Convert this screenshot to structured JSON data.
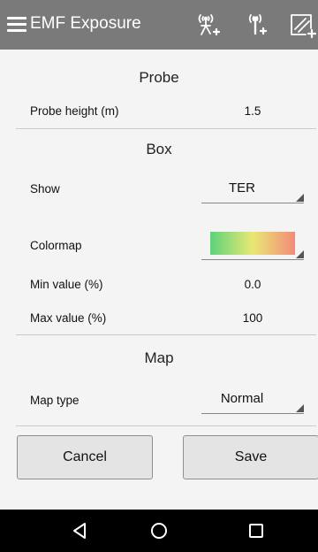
{
  "toolbar": {
    "title": "EMF Exposure",
    "icons": [
      "menu-icon",
      "add-antenna-icon",
      "add-transmitter-icon",
      "add-area-icon"
    ]
  },
  "probe": {
    "section_title": "Probe",
    "height_label": "Probe height (m)",
    "height_value": "1.5"
  },
  "box": {
    "section_title": "Box",
    "show_label": "Show",
    "show_value": "TER",
    "colormap_label": "Colormap",
    "colormap_colors": [
      "#5ed27a",
      "#e9e874",
      "#f38a7a"
    ],
    "min_label": "Min value (%)",
    "min_value": "0.0",
    "max_label": "Max value (%)",
    "max_value": "100"
  },
  "map": {
    "section_title": "Map",
    "type_label": "Map type",
    "type_value": "Normal"
  },
  "actions": {
    "cancel_label": "Cancel",
    "save_label": "Save"
  },
  "navbar": {
    "icons": [
      "back-icon",
      "home-icon",
      "recents-icon"
    ]
  },
  "colors": {
    "toolbar_bg": "#7a7a7a",
    "background": "#f4f4f4",
    "navbar_bg": "#000000"
  }
}
